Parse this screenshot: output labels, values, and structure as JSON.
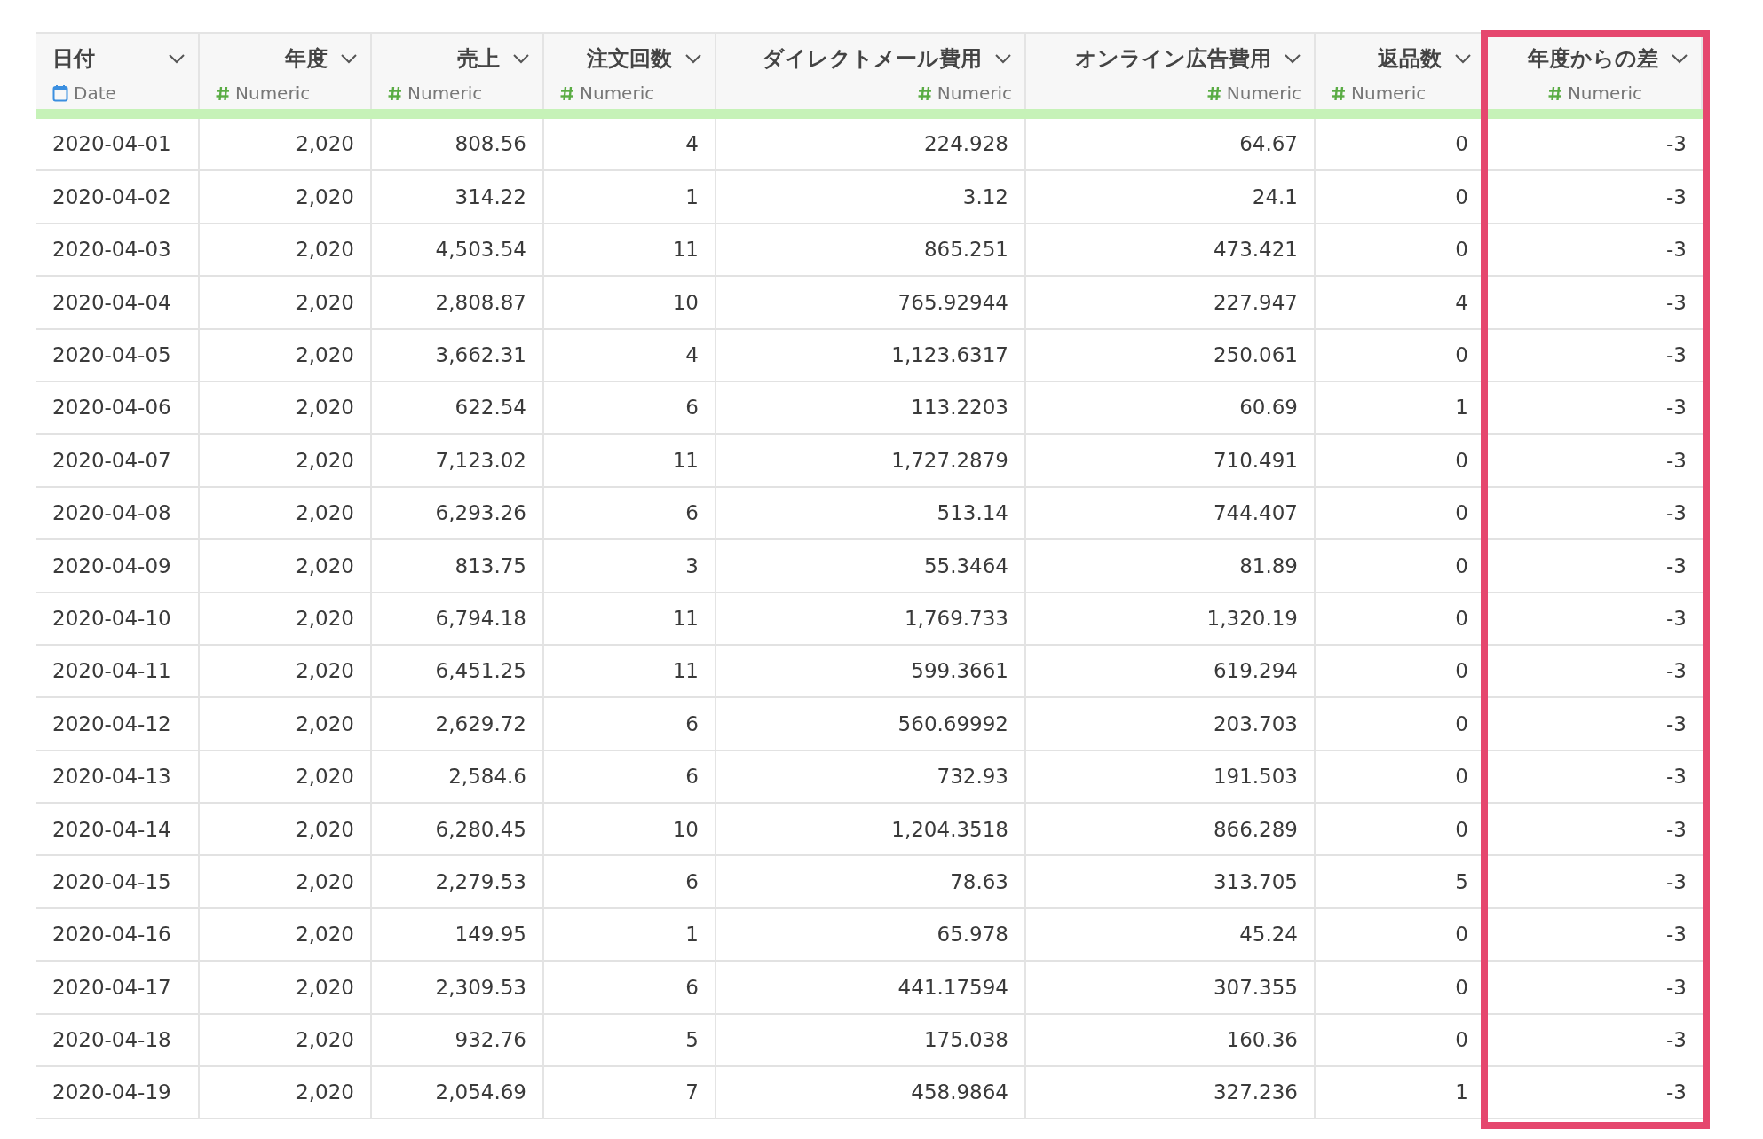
{
  "table": {
    "columns": [
      {
        "title": "日付",
        "type": "Date",
        "kind": "date",
        "highlighted": false
      },
      {
        "title": "年度",
        "type": "Numeric",
        "kind": "numeric",
        "highlighted": false
      },
      {
        "title": "売上",
        "type": "Numeric",
        "kind": "numeric",
        "highlighted": false
      },
      {
        "title": "注文回数",
        "type": "Numeric",
        "kind": "numeric",
        "highlighted": false
      },
      {
        "title": "ダイレクトメール費用",
        "type": "Numeric",
        "kind": "numeric",
        "highlighted": false
      },
      {
        "title": "オンライン広告費用",
        "type": "Numeric",
        "kind": "numeric",
        "highlighted": false
      },
      {
        "title": "返品数",
        "type": "Numeric",
        "kind": "numeric",
        "highlighted": false
      },
      {
        "title": "年度からの差",
        "type": "Numeric",
        "kind": "numeric",
        "highlighted": true
      }
    ],
    "rows": [
      [
        "2020-04-01",
        "2,020",
        "808.56",
        "4",
        "224.928",
        "64.67",
        "0",
        "-3"
      ],
      [
        "2020-04-02",
        "2,020",
        "314.22",
        "1",
        "3.12",
        "24.1",
        "0",
        "-3"
      ],
      [
        "2020-04-03",
        "2,020",
        "4,503.54",
        "11",
        "865.251",
        "473.421",
        "0",
        "-3"
      ],
      [
        "2020-04-04",
        "2,020",
        "2,808.87",
        "10",
        "765.92944",
        "227.947",
        "4",
        "-3"
      ],
      [
        "2020-04-05",
        "2,020",
        "3,662.31",
        "4",
        "1,123.6317",
        "250.061",
        "0",
        "-3"
      ],
      [
        "2020-04-06",
        "2,020",
        "622.54",
        "6",
        "113.2203",
        "60.69",
        "1",
        "-3"
      ],
      [
        "2020-04-07",
        "2,020",
        "7,123.02",
        "11",
        "1,727.2879",
        "710.491",
        "0",
        "-3"
      ],
      [
        "2020-04-08",
        "2,020",
        "6,293.26",
        "6",
        "513.14",
        "744.407",
        "0",
        "-3"
      ],
      [
        "2020-04-09",
        "2,020",
        "813.75",
        "3",
        "55.3464",
        "81.89",
        "0",
        "-3"
      ],
      [
        "2020-04-10",
        "2,020",
        "6,794.18",
        "11",
        "1,769.733",
        "1,320.19",
        "0",
        "-3"
      ],
      [
        "2020-04-11",
        "2,020",
        "6,451.25",
        "11",
        "599.3661",
        "619.294",
        "0",
        "-3"
      ],
      [
        "2020-04-12",
        "2,020",
        "2,629.72",
        "6",
        "560.69992",
        "203.703",
        "0",
        "-3"
      ],
      [
        "2020-04-13",
        "2,020",
        "2,584.6",
        "6",
        "732.93",
        "191.503",
        "0",
        "-3"
      ],
      [
        "2020-04-14",
        "2,020",
        "6,280.45",
        "10",
        "1,204.3518",
        "866.289",
        "0",
        "-3"
      ],
      [
        "2020-04-15",
        "2,020",
        "2,279.53",
        "6",
        "78.63",
        "313.705",
        "5",
        "-3"
      ],
      [
        "2020-04-16",
        "2,020",
        "149.95",
        "1",
        "65.978",
        "45.24",
        "0",
        "-3"
      ],
      [
        "2020-04-17",
        "2,020",
        "2,309.53",
        "6",
        "441.17594",
        "307.355",
        "0",
        "-3"
      ],
      [
        "2020-04-18",
        "2,020",
        "932.76",
        "5",
        "175.038",
        "160.36",
        "0",
        "-3"
      ],
      [
        "2020-04-19",
        "2,020",
        "2,054.69",
        "7",
        "458.9864",
        "327.236",
        "1",
        "-3"
      ]
    ]
  }
}
